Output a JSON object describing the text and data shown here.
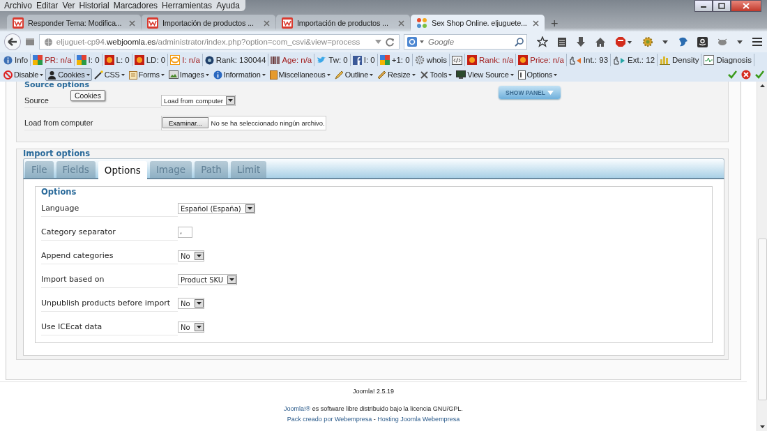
{
  "menu": [
    "Archivo",
    "Editar",
    "Ver",
    "Historial",
    "Marcadores",
    "Herramientas",
    "Ayuda"
  ],
  "browser_tabs": [
    {
      "title": "Responder Tema: Modifica...",
      "selected": false
    },
    {
      "title": "Importación de productos ...",
      "selected": false
    },
    {
      "title": "Importación de productos ...",
      "selected": false
    },
    {
      "title": "Sex Shop Online. eljuguete...",
      "selected": true
    }
  ],
  "new_tab": "+",
  "url": "eljuguet-cp94.**webjoomla.es**/administrator/index.php?option=com_csvi&view=process",
  "search": {
    "placeholder": "Google"
  },
  "seo_bar": [
    {
      "kind": "info",
      "label": "Info",
      "alert": false
    },
    {
      "kind": "google",
      "label": "PR: n/a",
      "alert": true
    },
    {
      "kind": "google",
      "label": "I: 0",
      "alert": false
    },
    {
      "kind": "sun",
      "label": "L: 0",
      "alert": false
    },
    {
      "kind": "sun",
      "label": "LD: 0",
      "alert": false
    },
    {
      "kind": "ring",
      "label": "I: n/a",
      "alert": true
    },
    {
      "kind": "alexa",
      "label": "Rank: 130044",
      "alert": false
    },
    {
      "kind": "barcode",
      "label": "Age: n/a",
      "alert": true
    },
    {
      "kind": "twitter",
      "label": "Tw: 0",
      "alert": false
    },
    {
      "kind": "facebook",
      "label": "I: 0",
      "alert": false
    },
    {
      "kind": "google",
      "label": "+1: 0",
      "alert": false
    },
    {
      "kind": "gear",
      "label": "whois",
      "alert": false
    },
    {
      "kind": "code"
    },
    {
      "kind": "sun",
      "label": "Rank: n/a",
      "alert": true
    },
    {
      "kind": "sun",
      "label": "Price: n/a",
      "alert": true
    },
    {
      "kind": "hand-in",
      "label": "Int.: 93",
      "alert": false
    },
    {
      "kind": "hand-out",
      "label": "Ext.: 12",
      "alert": false
    },
    {
      "kind": "bars",
      "label": "Density",
      "alert": false
    },
    {
      "kind": "pulse",
      "label": "Diagnosis",
      "alert": false
    }
  ],
  "dev_bar": [
    {
      "kind": "disable",
      "label": "Disable",
      "selected": false
    },
    {
      "kind": "person",
      "label": "Cookies",
      "selected": true
    },
    {
      "kind": "wand",
      "label": "CSS",
      "selected": false
    },
    {
      "kind": "clipboard",
      "label": "Forms",
      "selected": false
    },
    {
      "kind": "image",
      "label": "Images",
      "selected": false
    },
    {
      "kind": "info",
      "label": "Information",
      "selected": false
    },
    {
      "kind": "box",
      "label": "Miscellaneous",
      "selected": false
    },
    {
      "kind": "pencil",
      "label": "Outline",
      "selected": false
    },
    {
      "kind": "ruler",
      "label": "Resize",
      "selected": false
    },
    {
      "kind": "tools",
      "label": "Tools",
      "selected": false
    },
    {
      "kind": "screen",
      "label": "View Source",
      "selected": false
    },
    {
      "kind": "page",
      "label": "Options",
      "selected": false
    }
  ],
  "tooltip": "Cookies",
  "source_options": {
    "legend": "Source options",
    "source_label": "Source",
    "source_value": "Load from computer",
    "file_label": "Load from computer",
    "browse_button": "Examinar...",
    "file_status": "No se ha seleccionado ningún archivo.",
    "show_panel": "SHOW PANEL"
  },
  "import_options": {
    "legend": "Import options",
    "tabs": [
      {
        "label": "File",
        "selected": false
      },
      {
        "label": "Fields",
        "selected": false
      },
      {
        "label": "Options",
        "selected": true
      },
      {
        "label": "Image",
        "selected": false
      },
      {
        "label": "Path",
        "selected": false
      },
      {
        "label": "Limit",
        "selected": false
      }
    ],
    "legend_inner": "Options",
    "rows": [
      {
        "label": "Language",
        "kind": "select",
        "value": "Español (España)"
      },
      {
        "label": "Category separator",
        "kind": "text",
        "value": ","
      },
      {
        "label": "Append categories",
        "kind": "select",
        "value": "No"
      },
      {
        "label": "Import based on",
        "kind": "select",
        "value": "Product SKU"
      },
      {
        "label": "Unpublish products before import",
        "kind": "select",
        "value": "No"
      },
      {
        "label": "Use ICEcat data",
        "kind": "select",
        "value": "No"
      }
    ]
  },
  "footer": {
    "version": "Joomla! 2.5.19",
    "license_link": "Joomla!®",
    "license_text": " es software libre distribuido bajo la licencia GNU/GPL.",
    "pack_link": "Pack creado por Webempresa",
    "separator": " - ",
    "hosting_link": "Hosting Joomla Webempresa"
  }
}
